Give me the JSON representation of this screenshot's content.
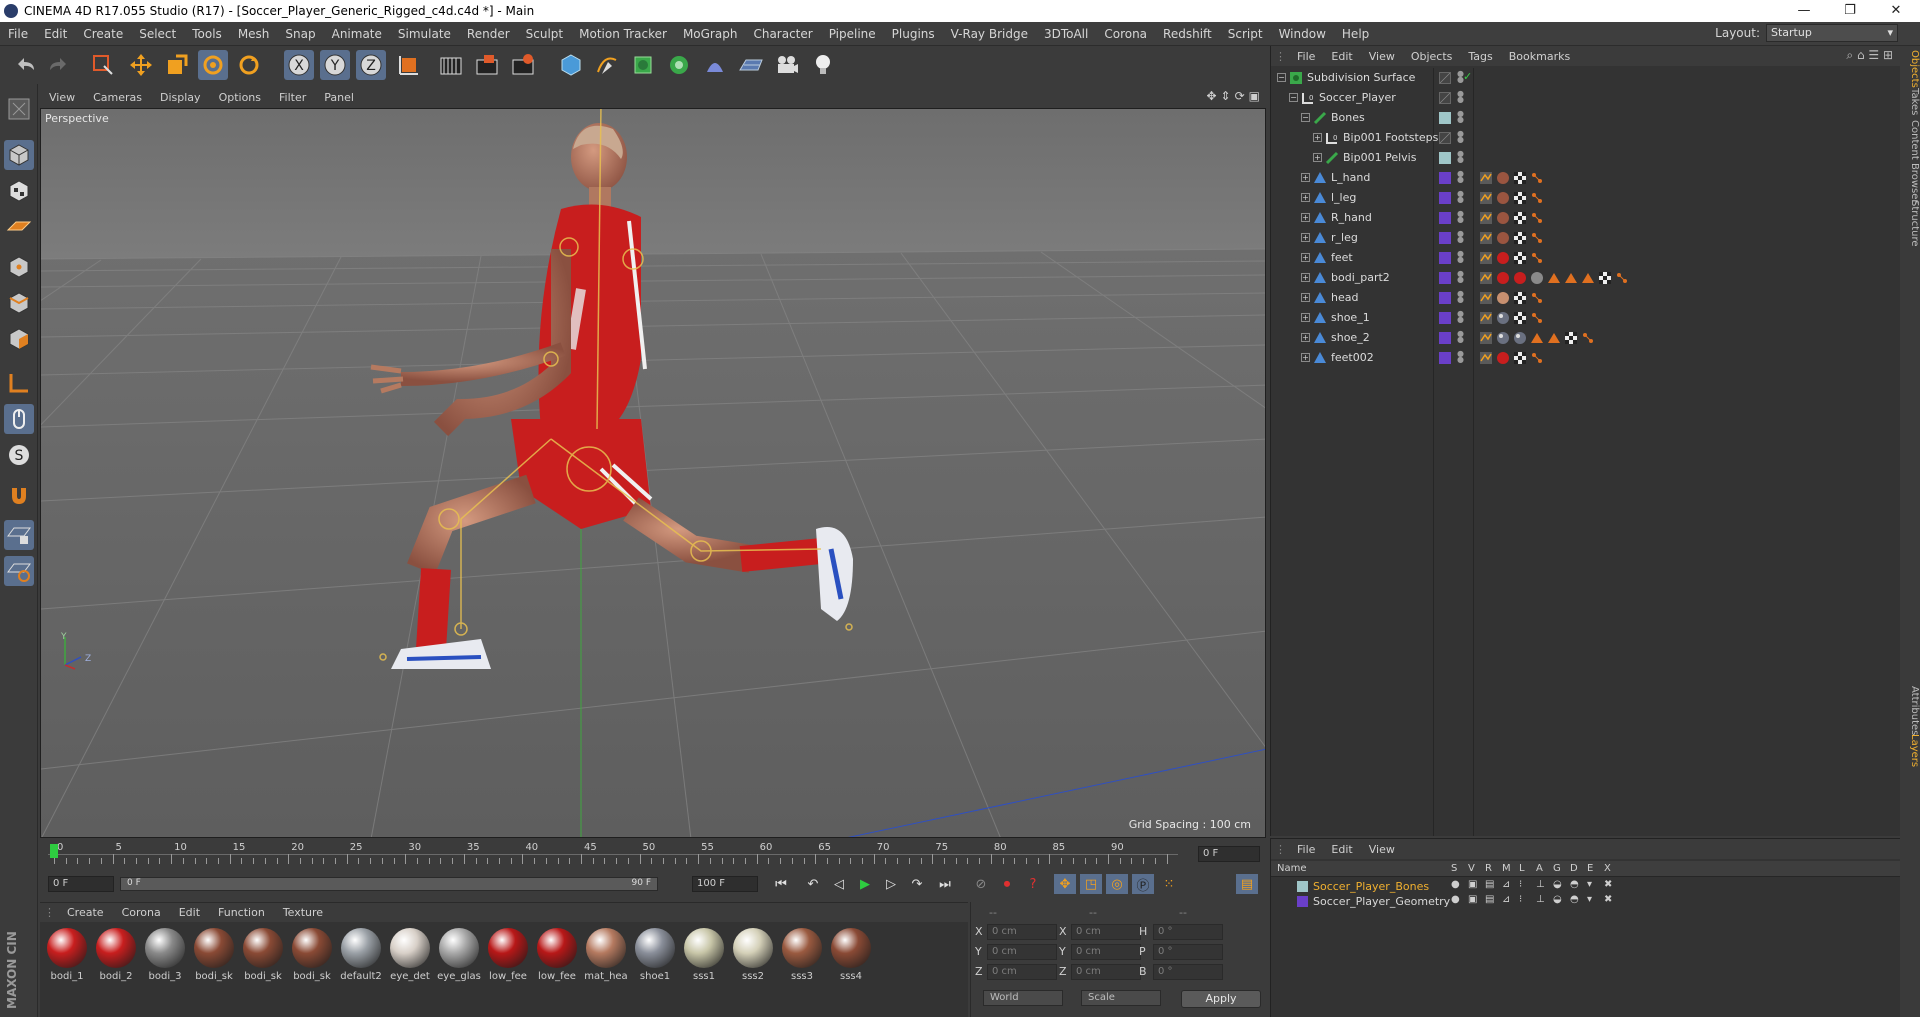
{
  "window": {
    "title": "CINEMA 4D R17.055 Studio (R17) - [Soccer_Player_Generic_Rigged_c4d.c4d *] - Main",
    "minimize": "—",
    "maximize": "❐",
    "close": "✕"
  },
  "menubar": {
    "items": [
      "File",
      "Edit",
      "Create",
      "Select",
      "Tools",
      "Mesh",
      "Snap",
      "Animate",
      "Simulate",
      "Render",
      "Sculpt",
      "Motion Tracker",
      "MoGraph",
      "Character",
      "Pipeline",
      "Plugins",
      "V-Ray Bridge",
      "3DToAll",
      "Corona",
      "Redshift",
      "Script",
      "Window",
      "Help"
    ],
    "layout_label": "Layout:",
    "layout_value": "Startup"
  },
  "toolbar": {
    "icons": [
      "undo-icon",
      "redo-icon",
      "live-selection-icon",
      "move-icon",
      "scale-icon",
      "rotate-icon",
      "recent-tool-icon",
      "x-axis-icon",
      "y-axis-icon",
      "z-axis-icon",
      "coordinate-system-icon",
      "render-view-icon",
      "render-picture-viewer-icon",
      "edit-render-settings-icon",
      "cube-icon",
      "pen-spline-icon",
      "subdivision-icon",
      "cloner-icon",
      "deformer-icon",
      "floor-icon",
      "camera-icon",
      "light-icon"
    ],
    "axis_labels": [
      "X",
      "Y",
      "Z"
    ]
  },
  "lefttoolbar": {
    "icons": [
      "make-editable-icon",
      "model-mode-icon",
      "texture-mode-icon",
      "workplane-icon",
      "points-mode-icon",
      "edges-mode-icon",
      "polygons-mode-icon",
      "axis-mode-icon",
      "tweak-mode-icon",
      "snap-icon",
      "magnet-icon",
      "workplane-lock-icon",
      "locked-workplane-icon"
    ],
    "s_label": "S",
    "brand": "MAXON CINEMA 4D"
  },
  "viewport": {
    "menu": [
      "View",
      "Cameras",
      "Display",
      "Options",
      "Filter",
      "Panel"
    ],
    "label": "Perspective",
    "grid_spacing": "Grid Spacing : 100 cm",
    "axis_labels": {
      "y": "Y",
      "z": "Z"
    }
  },
  "timeline": {
    "ticks": [
      "0",
      "5",
      "10",
      "15",
      "20",
      "25",
      "30",
      "35",
      "40",
      "45",
      "50",
      "55",
      "60",
      "65",
      "70",
      "75",
      "80",
      "85",
      "90"
    ],
    "current_frame": "0 F",
    "start_field": "0 F",
    "range_start": "0 F",
    "range_end": "90 F",
    "end_field": "100 F"
  },
  "materials": {
    "menu": [
      "Create",
      "Corona",
      "Edit",
      "Function",
      "Texture"
    ],
    "items": [
      {
        "label": "bodi_1",
        "color": "#c81e1e"
      },
      {
        "label": "bodi_2",
        "color": "#c81e1e"
      },
      {
        "label": "bodi_3",
        "color": "#8a8a8a"
      },
      {
        "label": "bodi_sk",
        "color": "#8a4a35"
      },
      {
        "label": "bodi_sk",
        "color": "#8a4a35"
      },
      {
        "label": "bodi_sk",
        "color": "#8a4a35"
      },
      {
        "label": "default2",
        "color": "#9aa0a6"
      },
      {
        "label": "eye_det",
        "color": "#d8d0c8"
      },
      {
        "label": "eye_glas",
        "color": "#a8a8a8"
      },
      {
        "label": "low_fee",
        "color": "#b81818"
      },
      {
        "label": "low_fee",
        "color": "#b81818"
      },
      {
        "label": "mat_hea",
        "color": "#b57a60"
      },
      {
        "label": "shoe1",
        "color": "#8a8f9a"
      },
      {
        "label": "sss1",
        "color": "#c8c6a8"
      },
      {
        "label": "sss2",
        "color": "#d4d0b8"
      },
      {
        "label": "sss3",
        "color": "#9a5a40"
      },
      {
        "label": "sss4",
        "color": "#8a4a35"
      }
    ]
  },
  "coordinates": {
    "headers": [
      "--",
      "--",
      "--"
    ],
    "rows": [
      {
        "a": "X",
        "av": "0 cm",
        "b": "X",
        "bv": "0 cm",
        "c": "H",
        "cv": "0 °"
      },
      {
        "a": "Y",
        "av": "0 cm",
        "b": "Y",
        "bv": "0 cm",
        "c": "P",
        "cv": "0 °"
      },
      {
        "a": "Z",
        "av": "0 cm",
        "b": "Z",
        "bv": "0 cm",
        "c": "B",
        "cv": "0 °"
      }
    ],
    "world": "World",
    "scale": "Scale",
    "apply": "Apply"
  },
  "objectmanager": {
    "menu": [
      "File",
      "Edit",
      "View",
      "Objects",
      "Tags",
      "Bookmarks"
    ],
    "objects": [
      {
        "name": "Subdivision Surface",
        "indent": 0,
        "icon": "subdivision-surface-icon",
        "swatch": "none",
        "tags": []
      },
      {
        "name": "Soccer_Player",
        "indent": 1,
        "icon": "null-object-icon",
        "swatch": "none",
        "tags": []
      },
      {
        "name": "Bones",
        "indent": 2,
        "icon": "bone-icon",
        "swatch": "#9fc6c8",
        "tags": []
      },
      {
        "name": "Bip001 Footsteps",
        "indent": 3,
        "icon": "null-object-icon",
        "swatch": "none",
        "tags": []
      },
      {
        "name": "Bip001 Pelvis",
        "indent": 3,
        "icon": "bone-icon",
        "swatch": "#9fc6c8",
        "tags": []
      },
      {
        "name": "L_hand",
        "indent": 2,
        "icon": "polygon-object-icon",
        "swatch": "#6a3fc8",
        "tags": [
          "weight",
          "skin",
          "check",
          "joint"
        ]
      },
      {
        "name": "l_leg",
        "indent": 2,
        "icon": "polygon-object-icon",
        "swatch": "#6a3fc8",
        "tags": [
          "weight",
          "skin",
          "check",
          "joint"
        ]
      },
      {
        "name": "R_hand",
        "indent": 2,
        "icon": "polygon-object-icon",
        "swatch": "#6a3fc8",
        "tags": [
          "weight",
          "skin",
          "check",
          "joint"
        ]
      },
      {
        "name": "r_leg",
        "indent": 2,
        "icon": "polygon-object-icon",
        "swatch": "#6a3fc8",
        "tags": [
          "weight",
          "skin",
          "check",
          "joint"
        ]
      },
      {
        "name": "feet",
        "indent": 2,
        "icon": "polygon-object-icon",
        "swatch": "#6a3fc8",
        "tags": [
          "weight",
          "red",
          "check",
          "joint"
        ]
      },
      {
        "name": "bodi_part2",
        "indent": 2,
        "icon": "polygon-object-icon",
        "swatch": "#6a3fc8",
        "tags": [
          "weight",
          "red",
          "red",
          "grey",
          "tri",
          "tri",
          "tri",
          "check",
          "joint"
        ]
      },
      {
        "name": "head",
        "indent": 2,
        "icon": "polygon-object-icon",
        "swatch": "#6a3fc8",
        "tags": [
          "weight",
          "head",
          "check",
          "joint"
        ]
      },
      {
        "name": "shoe_1",
        "indent": 2,
        "icon": "polygon-object-icon",
        "swatch": "#6a3fc8",
        "tags": [
          "weight",
          "shoe",
          "check",
          "joint"
        ]
      },
      {
        "name": "shoe_2",
        "indent": 2,
        "icon": "polygon-object-icon",
        "swatch": "#6a3fc8",
        "tags": [
          "weight",
          "shoe",
          "shoe",
          "tri",
          "tri",
          "check",
          "joint"
        ]
      },
      {
        "name": "feet002",
        "indent": 2,
        "icon": "polygon-object-icon",
        "swatch": "#6a3fc8",
        "tags": [
          "weight",
          "red",
          "check",
          "joint"
        ]
      }
    ]
  },
  "layers": {
    "menu": [
      "File",
      "Edit",
      "View"
    ],
    "headers": [
      "Name",
      "S",
      "V",
      "R",
      "M",
      "L",
      "A",
      "G",
      "D",
      "E",
      "X"
    ],
    "items": [
      {
        "name": "Soccer_Player_Bones",
        "color": "#9fc6c8",
        "text_color": "#f0b030"
      },
      {
        "name": "Soccer_Player_Geometry",
        "color": "#6a3fc8",
        "text_color": "#d8d8d8"
      }
    ]
  },
  "right_tabs": [
    {
      "label": "Objects",
      "active": true
    },
    {
      "label": "Takes",
      "active": false
    },
    {
      "label": "Content Browser",
      "active": false
    },
    {
      "label": "Structure",
      "active": false
    },
    {
      "label": "Attributes",
      "active": false
    },
    {
      "label": "Layers",
      "active": true
    }
  ],
  "colors": {
    "accent": "#f0b030",
    "active_button": "#5a6f8e",
    "viewport_bg": "#7a7a7a",
    "jersey": "#c81e1e"
  }
}
